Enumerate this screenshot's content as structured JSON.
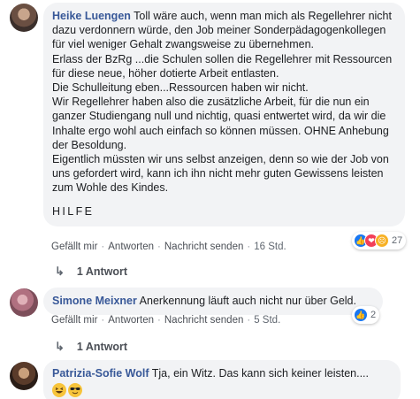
{
  "comments": [
    {
      "author": "Heike Luengen",
      "paragraphs": [
        "Toll wäre auch, wenn man mich als Regellehrer nicht dazu verdonnern würde, den Job meiner Sonderpädagogenkollegen für viel weniger Gehalt zwangsweise zu übernehmen.",
        "Erlass der BzRg ...die Schulen sollen die Regellehrer mit Ressourcen für diese neue, höher dotierte Arbeit entlasten.",
        "Die Schulleitung eben...Ressourcen haben wir nicht.",
        "Wir Regellehrer haben also die zusätzliche Arbeit, für die nun ein ganzer Studiengang null und nichtig, quasi entwertet wird, da wir die Inhalte ergo wohl auch einfach so können müssen. OHNE Anhebung der Besoldung.",
        "Eigentlich müssten wir uns selbst anzeigen, denn so wie der Job von uns gefordert wird, kann ich ihn nicht mehr guten Gewissens leisten zum Wohle des Kindes."
      ],
      "closing": "HILFE",
      "actions": {
        "like": "Gefällt mir",
        "reply": "Antworten",
        "message": "Nachricht senden",
        "time": "16 Std."
      },
      "reaction_count": "27",
      "reply_summary": "1 Antwort"
    },
    {
      "author": "Simone Meixner",
      "text": "Anerkennung läuft auch nicht nur über Geld.",
      "actions": {
        "like": "Gefällt mir",
        "reply": "Antworten",
        "message": "Nachricht senden",
        "time": "5 Std."
      },
      "reaction_count": "2",
      "reply_summary": "1 Antwort"
    },
    {
      "author": "Patrizia-Sofie Wolf",
      "text": "Tja, ein Witz. Das kann sich keiner leisten....",
      "emojis": [
        "laughing-emoji",
        "sunglasses-emoji"
      ]
    }
  ],
  "colors": {
    "name": "#385898",
    "bubble": "#f2f3f5",
    "meta": "#606770",
    "like": "#1877f2",
    "love": "#f33e58",
    "sad": "#f7b125"
  }
}
